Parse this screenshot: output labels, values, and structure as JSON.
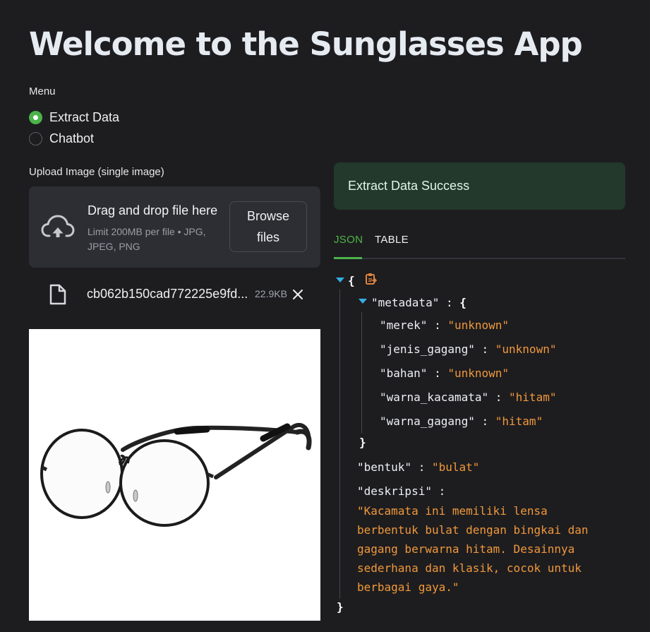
{
  "app": {
    "title": "Welcome to the Sunglasses App"
  },
  "menu": {
    "label": "Menu",
    "options": [
      {
        "label": "Extract Data",
        "selected": true
      },
      {
        "label": "Chatbot",
        "selected": false
      }
    ]
  },
  "uploader": {
    "label": "Upload Image (single image)",
    "drop_title": "Drag and drop file here",
    "limit_text": "Limit 200MB per file • JPG, JPEG, PNG",
    "browse_label": "Browse files",
    "file": {
      "name": "cb062b150cad772225e9fd...",
      "size": "22.9KB"
    }
  },
  "preview": {
    "subject": "round black wire-frame glasses"
  },
  "result": {
    "status": "Extract Data Success",
    "tabs": [
      {
        "label": "JSON",
        "active": true
      },
      {
        "label": "TABLE",
        "active": false
      }
    ],
    "json": {
      "metadata_key": "\"metadata\"",
      "metadata": [
        {
          "key": "\"merek\"",
          "value": "\"unknown\""
        },
        {
          "key": "\"jenis_gagang\"",
          "value": "\"unknown\""
        },
        {
          "key": "\"bahan\"",
          "value": "\"unknown\""
        },
        {
          "key": "\"warna_kacamata\"",
          "value": "\"hitam\""
        },
        {
          "key": "\"warna_gagang\"",
          "value": "\"hitam\""
        }
      ],
      "bentuk_key": "\"bentuk\"",
      "bentuk_value": "\"bulat\"",
      "deskripsi_key": "\"deskripsi\"",
      "deskripsi_value": "\"Kacamata ini memiliki lensa berbentuk bulat dengan bingkai dan gagang berwarna hitam. Desainnya sederhana dan klasik, cocok untuk berbagai gaya.\""
    }
  },
  "colors": {
    "background": "#1d1d20",
    "accent_green": "#4bb34a",
    "json_string": "#f0983a",
    "success_bg": "#22392b"
  },
  "icons": [
    "cloud-upload-icon",
    "file-icon",
    "close-icon",
    "copy-icon",
    "caret-down-icon"
  ]
}
